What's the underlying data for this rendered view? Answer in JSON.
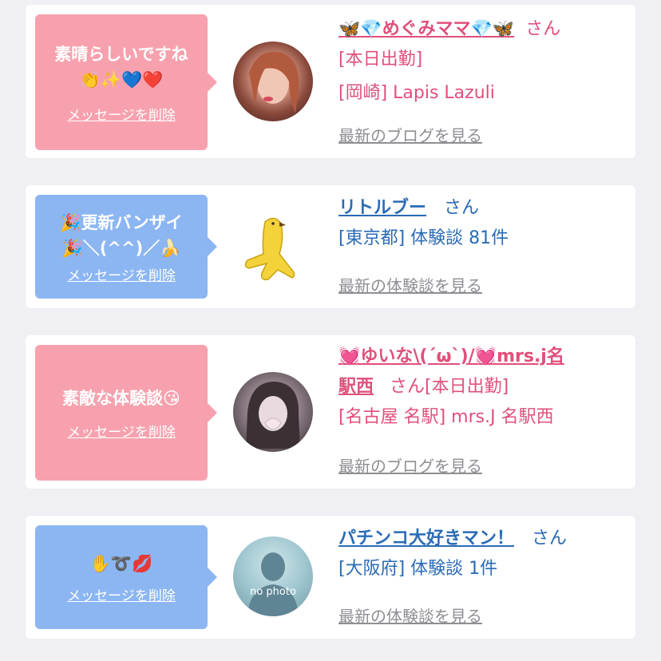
{
  "cards": [
    {
      "bubble_text": "素晴らしいですね\n👏✨💙❤️",
      "delete_label": "メッセージを削除",
      "name": "🦋💎めぐみママ💎🦋",
      "honorific": "さん",
      "status": "[本日出勤]",
      "location": "[岡崎] Lapis Lazuli",
      "more_link": "最新のブログを見る"
    },
    {
      "bubble_text": "🎉更新バンザイ\n🎉＼(^^)／🍌",
      "delete_label": "メッセージを削除",
      "name": "リトルブー",
      "honorific": "さん",
      "location": "[東京都] 体験談 81件",
      "more_link": "最新の体験談を見る"
    },
    {
      "bubble_text": "素敵な体験談😘",
      "delete_label": "メッセージを削除",
      "name_part1": "💓ゆいな\\(´ω`)/💓mrs.j名",
      "name_part2": "駅西",
      "honorific": "さん",
      "status": "[本日出勤]",
      "location": "[名古屋 名駅] mrs.J 名駅西",
      "more_link": "最新のブログを見る"
    },
    {
      "bubble_text": "✋➰💋",
      "delete_label": "メッセージを削除",
      "name": "パチンコ大好きマン！",
      "honorific": "さん",
      "location": "[大阪府] 体験談 1件",
      "more_link": "最新の体験談を見る",
      "avatar_text": "no photo"
    }
  ],
  "colors": {
    "pink_bubble": "#f8a1ae",
    "blue_bubble": "#8cb6f2",
    "pink_text": "#e0507a",
    "blue_text": "#2a6bb5"
  }
}
